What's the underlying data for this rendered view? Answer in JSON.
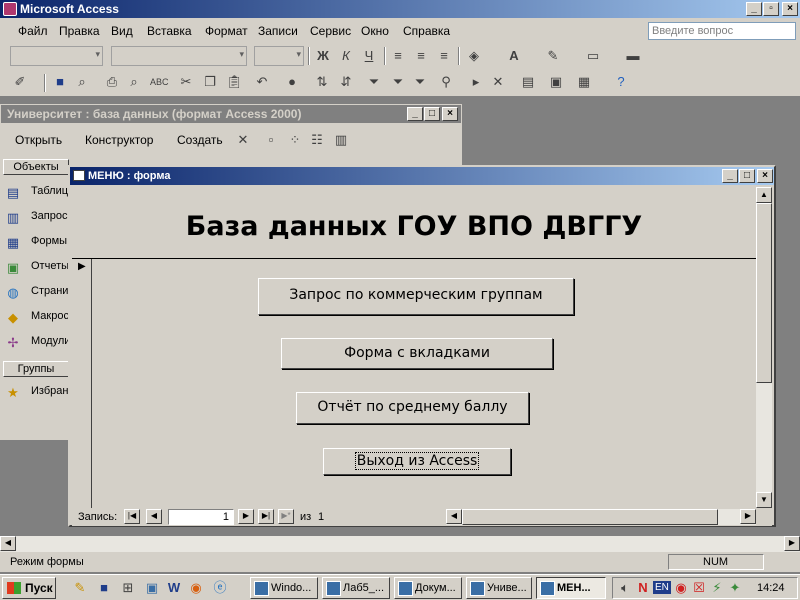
{
  "app": {
    "title": "Microsoft Access"
  },
  "menu": [
    "Файл",
    "Правка",
    "Вид",
    "Вставка",
    "Формат",
    "Записи",
    "Сервис",
    "Окно",
    "Справка"
  ],
  "help_placeholder": "Введите вопрос",
  "toolbar_format": {
    "bold": "Ж",
    "italic": "К",
    "underline": "Ч",
    "font_color": "A"
  },
  "db_window": {
    "title": "Университет : база данных (формат Access 2000)",
    "toolbar": [
      "Открыть",
      "Конструктор",
      "Создать"
    ],
    "objects_header": "Объекты",
    "objects": [
      "Таблиц",
      "Запрос",
      "Формы",
      "Отчеты",
      "Страни",
      "Макрос",
      "Модули"
    ],
    "groups_header": "Группы",
    "groups": [
      "Избран"
    ]
  },
  "form": {
    "title": "МЕНЮ : форма",
    "heading": "База данных ГОУ ВПО ДВГГУ",
    "buttons": [
      "Запрос по коммерческим группам",
      "Форма с вкладками",
      "Отчёт по среднему баллу",
      "Выход из Access"
    ],
    "nav": {
      "label": "Запись:",
      "current": "1",
      "of": "из",
      "total": "1"
    }
  },
  "status": {
    "mode": "Режим формы",
    "num": "NUM"
  },
  "taskbar": {
    "start": "Пуск",
    "tasks": [
      "Windo...",
      "Лаб5_...",
      "Докум...",
      "Униве...",
      "МЕН..."
    ],
    "lang": "EN",
    "clock": "14:24"
  }
}
